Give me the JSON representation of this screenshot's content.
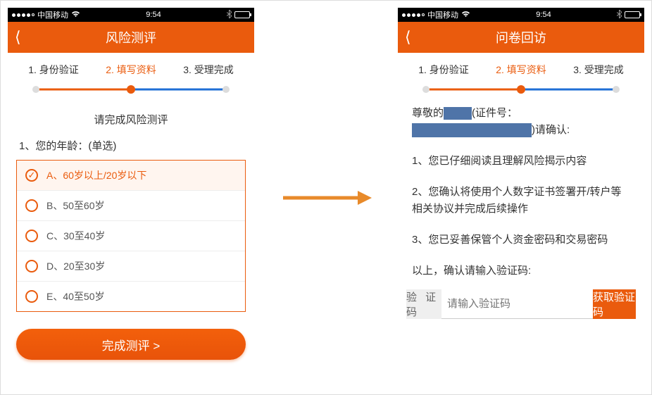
{
  "status": {
    "carrier": "中国移动",
    "time": "9:54"
  },
  "left": {
    "navTitle": "风险测评",
    "steps": {
      "s1": "1. 身份验证",
      "s2": "2. 填写资料",
      "s3": "3. 受理完成"
    },
    "tip": "请完成风险测评",
    "q1": "1、您的年龄：(单选)",
    "options": {
      "a": "A、60岁以上/20岁以下",
      "b": "B、50至60岁",
      "c": "C、30至40岁",
      "d": "D、20至30岁",
      "e": "E、40至50岁"
    },
    "submit": "完成测评 >"
  },
  "right": {
    "navTitle": "问卷回访",
    "steps": {
      "s1": "1. 身份验证",
      "s2": "2. 填写资料",
      "s3": "3. 受理完成"
    },
    "intro_prefix": "尊敬的",
    "intro_mid": "(证件号：",
    "intro_suffix": ")请确认:",
    "items": {
      "i1": "1、您已仔细阅读且理解风险揭示内容",
      "i2": "2、您确认将使用个人数字证书签署开/转户等相关协议并完成后续操作",
      "i3": "3、您已妥善保管个人资金密码和交易密码"
    },
    "confirm_line": "以上，确认请输入验证码:",
    "verify": {
      "label": "验 证 码",
      "placeholder": "请输入验证码",
      "button": "获取验证码"
    }
  }
}
